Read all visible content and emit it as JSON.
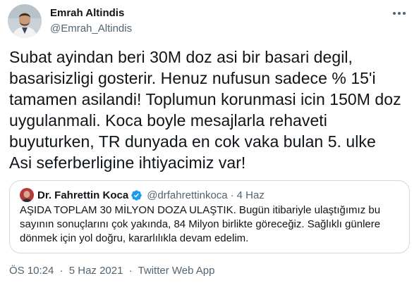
{
  "tweet": {
    "author_name": "Emrah Altindis",
    "author_handle": "@Emrah_Altindis",
    "more_icon": "more-horizontal-icon",
    "text_lines": [
      "Subat ayindan beri 30M doz asi bir basari degil,",
      "basarisizligi gosterir. Henuz nufusun sadece % 15'i",
      "tamamen asilandi! Toplumun korunmasi icin 150M doz",
      "uygulanmali. Koca boyle mesajlarla rehaveti",
      "buyuturken, TR dunyada en cok vaka bulan 5. ulke",
      "Asi seferberligine ihtiyacimiz var!"
    ]
  },
  "quote": {
    "author_name": "Dr. Fahrettin Koca",
    "verified_icon": "verified-badge-icon",
    "author_handle": "@drfahrettinkoca",
    "separator": "·",
    "date": "4 Haz",
    "text_lines": [
      "AŞIDA TOPLAM 30 MİLYON DOZA ULAŞTIK. Bugün itibariyle ulaştığımız bu",
      "sayının sonuçlarını çok yakında, 84 Milyon birlikte göreceğiz. Sağlıklı günlere",
      "dönmek için yol doğru, kararlılıkla devam edelim."
    ]
  },
  "meta": {
    "time": "ÖS 10:24",
    "separator": "·",
    "date": "5 Haz 2021",
    "source": "Twitter Web App"
  },
  "colors": {
    "text": "#0f1419",
    "secondary": "#536471",
    "border": "#cfd9de",
    "verified": "#1d9bf0"
  }
}
